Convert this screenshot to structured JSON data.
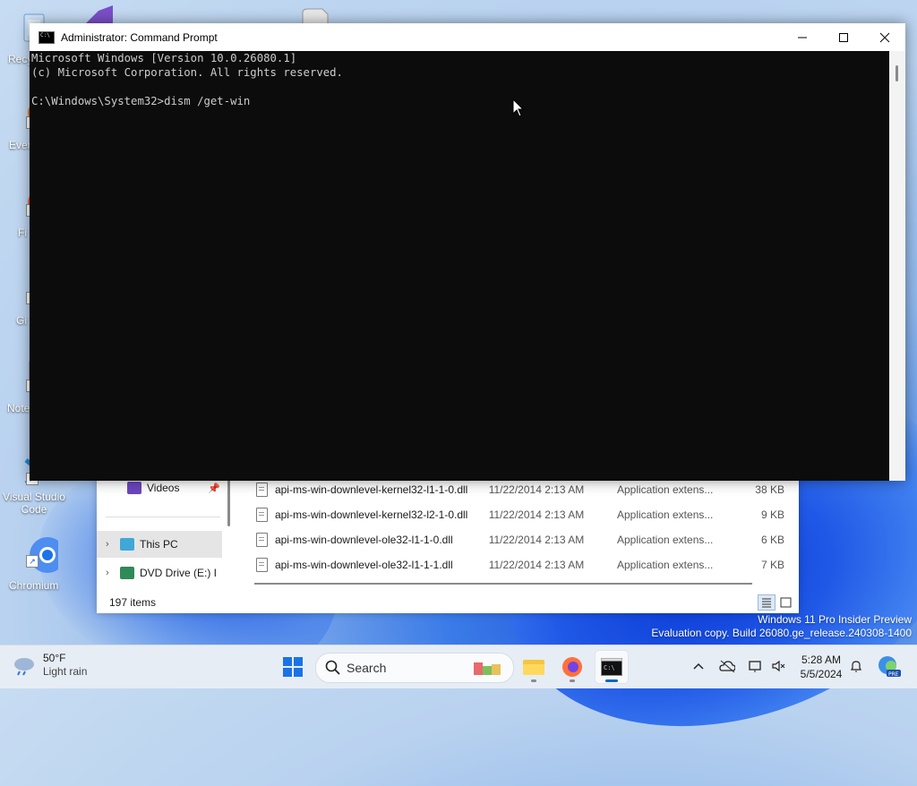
{
  "desktop": {
    "icons": [
      {
        "label": "Recy",
        "name": "recycle-bin"
      },
      {
        "label": "Ever",
        "name": "everything"
      },
      {
        "label": "Fi",
        "name": "firefox"
      },
      {
        "label": "Gi",
        "name": "git"
      },
      {
        "label": "Note",
        "name": "notepad-plus-plus"
      },
      {
        "label": "Visual Studio Code",
        "name": "vscode"
      },
      {
        "label": "Chromium",
        "name": "chromium"
      }
    ],
    "watermark": {
      "line1": "Windows 11 Pro Insider Preview",
      "line2": "Evaluation copy. Build 26080.ge_release.240308-1400"
    }
  },
  "cmd_window": {
    "title": "Administrator: Command Prompt",
    "console_lines": [
      "Microsoft Windows [Version 10.0.26080.1]",
      "(c) Microsoft Corporation. All rights reserved.",
      "",
      "C:\\Windows\\System32>dism /get-win"
    ],
    "buttons": {
      "minimize": "—",
      "maximize": "☐",
      "close": "✕"
    }
  },
  "explorer": {
    "nav": [
      {
        "label": "Videos",
        "icon": "videos-folder-icon",
        "pinned": true
      },
      {
        "label": "This PC",
        "icon": "this-pc-icon"
      },
      {
        "label": "DVD Drive (E:) IR",
        "icon": "dvd-drive-icon"
      }
    ],
    "files": [
      {
        "name": "api-ms-win-downlevel-kernel32-l1-1-0.dll",
        "date": "11/22/2014 2:13 AM",
        "type": "Application extens...",
        "size": "38 KB"
      },
      {
        "name": "api-ms-win-downlevel-kernel32-l2-1-0.dll",
        "date": "11/22/2014 2:13 AM",
        "type": "Application extens...",
        "size": "9 KB"
      },
      {
        "name": "api-ms-win-downlevel-ole32-l1-1-0.dll",
        "date": "11/22/2014 2:13 AM",
        "type": "Application extens...",
        "size": "6 KB"
      },
      {
        "name": "api-ms-win-downlevel-ole32-l1-1-1.dll",
        "date": "11/22/2014 2:13 AM",
        "type": "Application extens...",
        "size": "7 KB"
      }
    ],
    "status": "197 items"
  },
  "taskbar": {
    "weather": {
      "temp": "50°F",
      "condition": "Light rain"
    },
    "search_label": "Search",
    "apps": [
      "start-button",
      "search",
      "file-explorer",
      "firefox",
      "command-prompt"
    ],
    "clock": {
      "time": "5:28 AM",
      "date": "5/5/2024"
    }
  }
}
